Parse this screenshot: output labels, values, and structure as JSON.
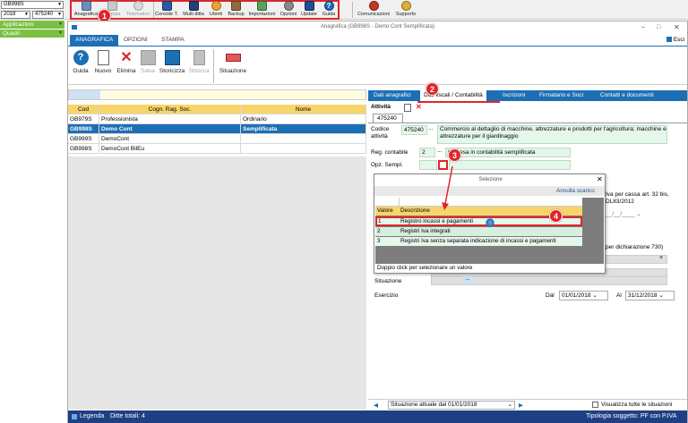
{
  "topbar": {
    "company_code": "GB998S",
    "year": "2018",
    "code": "475240",
    "nav_apps": "Applicazioni",
    "nav_frames": "Quadri",
    "buttons": [
      "Anagrafica",
      "Stampa",
      "Telematico",
      "Console T.",
      "Multi ditta",
      "Utenti",
      "Backup",
      "Importazioni",
      "Opzioni",
      "Update",
      "Guida",
      "Comunicazioni",
      "Supporto"
    ]
  },
  "window": {
    "title": "Anagrafica (GB998S - Demo Cont Semplificata)",
    "exit": "Esci"
  },
  "ribbon": {
    "tabs": [
      "ANAGRAFICA",
      "OPZIONI",
      "STAMPA"
    ],
    "buttons": [
      "Guida",
      "Nuovo",
      "Elimina",
      "Salva",
      "Storicizza",
      "Sblocca",
      "Situazione"
    ]
  },
  "grid": {
    "headers": [
      "Cod",
      "Cogn. Rag. Soc.",
      "Nome"
    ],
    "rows": [
      [
        "GB979S",
        "Professionista",
        "Ordinario"
      ],
      [
        "GB998S",
        "Demo Cont",
        "Semplificata"
      ],
      [
        "GB999S",
        "DemoCont",
        ""
      ],
      [
        "GB998S",
        "DemoCont BilEu",
        ""
      ]
    ]
  },
  "detail": {
    "tabs": [
      "Dati anagrafici",
      "Dati fiscali / Contabilità",
      "Iscrizioni",
      "Firmatario e Soci",
      "Contatti e documenti"
    ],
    "section": "Attività",
    "activity_code_tab": "475240",
    "codice_label": "Codice attività",
    "codice_value": "475240",
    "codice_desc": "Commercio al dettaglio di macchine, attrezzature e prodotti per l'agricoltura; macchine e attrezzature per il giardinaggio",
    "reg_label": "Reg. contabile",
    "reg_value": "2",
    "reg_desc": "Impresa  in contabilità semplificata",
    "opz_label": "Opz. Sempl.",
    "iva_text": "Iva per cassa art. 32 bis, DL83/2012",
    "dichiarazione_text": "per dichiarazione 730)",
    "date_placeholder": "__/__/____",
    "situazione_label": "Situazione",
    "esercizio_label": "Esercizio",
    "dal_label": "Dal",
    "dal_value": "01/01/2018",
    "al_label": "Al",
    "al_value": "31/12/2018"
  },
  "popup": {
    "title": "Selezione",
    "cancel": "Annulla scarico",
    "col_value": "Valore",
    "col_desc": "Descrizione",
    "options": [
      {
        "value": "1",
        "desc": "Registro incassi e pagamenti"
      },
      {
        "value": "2",
        "desc": "Registri Iva integrati"
      },
      {
        "value": "3",
        "desc": "Registri Iva senza separata indicazione di incassi e pagamenti"
      }
    ],
    "hint": "Doppio click per selezionare un valore"
  },
  "statusbar": {
    "situation": "Situazione attuale dal 01/01/2018",
    "checkbox": "Visualizza tutte le situazioni"
  },
  "footer": {
    "legend": "Legenda",
    "total": "Ditte totali: 4",
    "type": "Tipologia soggetto: PF con P.IVA"
  },
  "annotations": [
    "1",
    "2",
    "3",
    "4"
  ],
  "colors": {
    "accent": "#1c6fb5",
    "header_yellow": "#f7d56b",
    "field_green": "#e5f6ea",
    "annotation_red": "#e0252b",
    "footer_navy": "#1f3f84"
  }
}
